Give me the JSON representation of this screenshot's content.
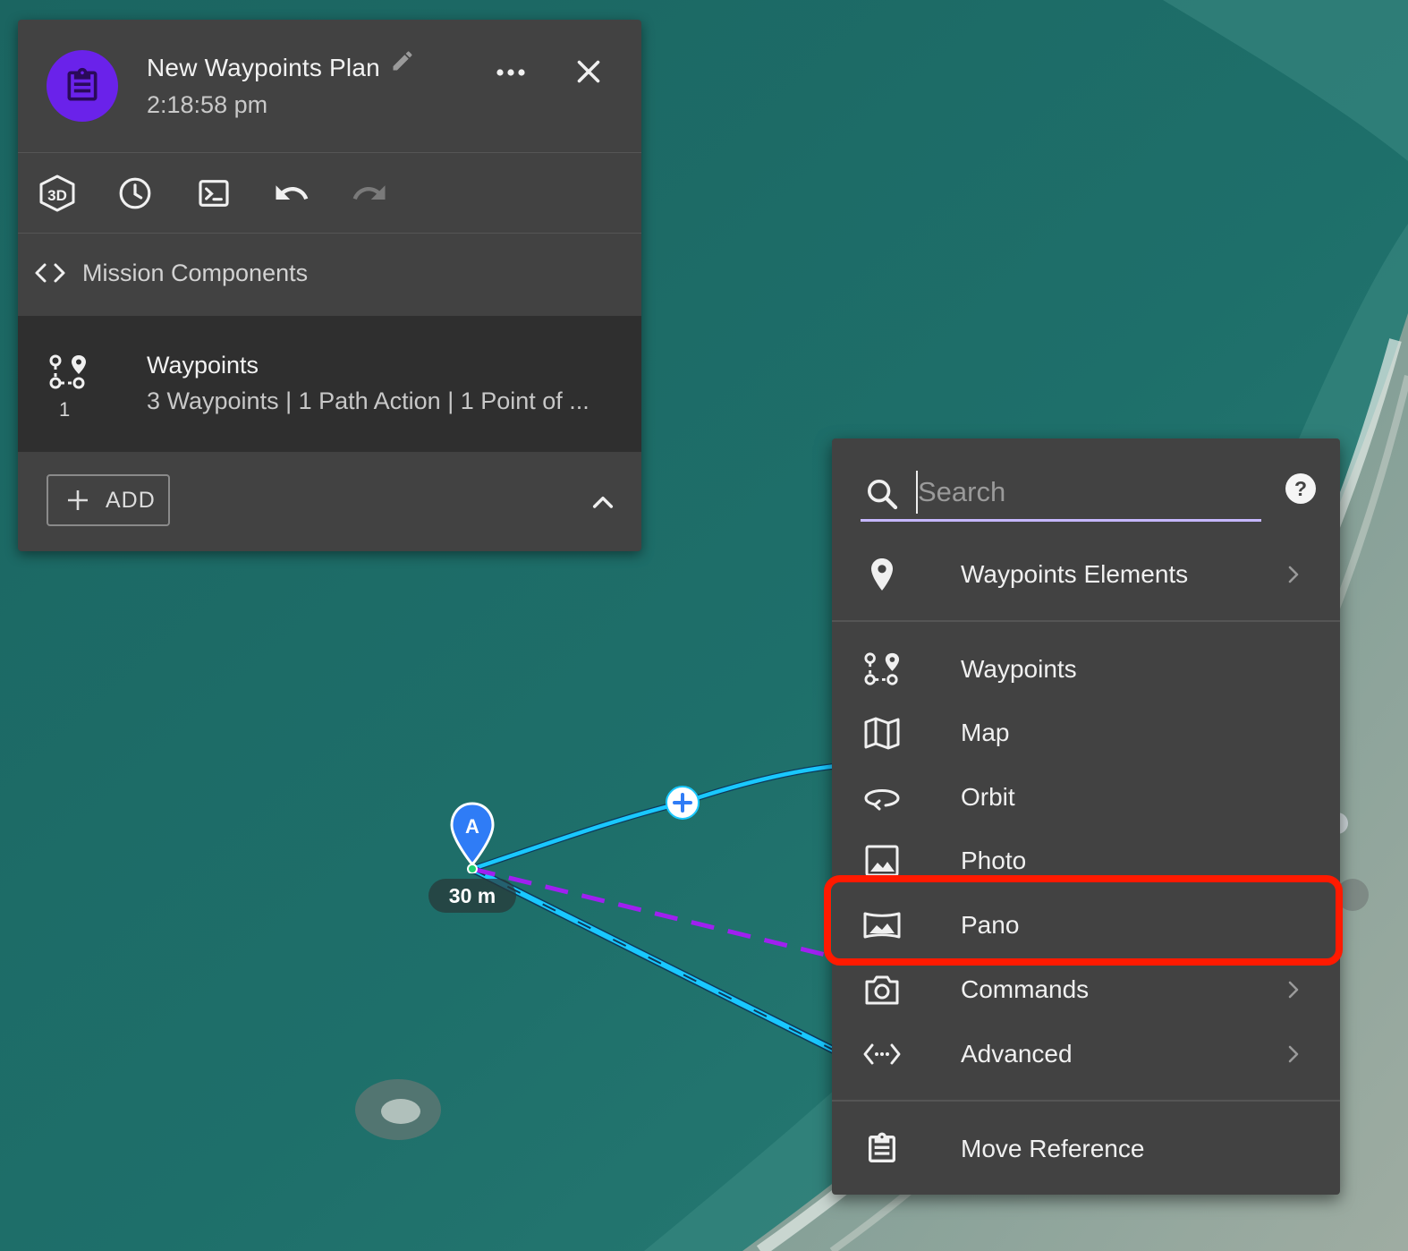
{
  "panel": {
    "title": "New Waypoints Plan",
    "time": "2:18:58 pm",
    "toolbar": {
      "view3d_icon": "3d-view-icon",
      "history_icon": "clock-icon",
      "terminal_icon": "terminal-icon",
      "undo_icon": "undo-icon",
      "redo_icon": "redo-icon"
    },
    "section_label": "Mission Components",
    "component": {
      "title": "Waypoints",
      "subtitle": "3 Waypoints | 1 Path Action | 1 Point of ...",
      "count": "1"
    },
    "add_label": "ADD"
  },
  "map": {
    "marker_label": "A",
    "altitude": "30 m"
  },
  "menu": {
    "search_placeholder": "Search",
    "items": [
      {
        "label": "Waypoints Elements",
        "icon": "location-pin-icon",
        "submenu": true
      },
      {
        "label": "Waypoints",
        "icon": "waypoints-route-icon",
        "submenu": false
      },
      {
        "label": "Map",
        "icon": "map-icon",
        "submenu": false
      },
      {
        "label": "Orbit",
        "icon": "orbit-icon",
        "submenu": false
      },
      {
        "label": "Photo",
        "icon": "photo-icon",
        "submenu": false
      },
      {
        "label": "Pano",
        "icon": "panorama-icon",
        "submenu": false
      },
      {
        "label": "Commands",
        "icon": "camera-icon",
        "submenu": true
      },
      {
        "label": "Advanced",
        "icon": "code-dots-icon",
        "submenu": true
      },
      {
        "label": "Move Reference",
        "icon": "clipboard-icon",
        "submenu": false
      }
    ]
  },
  "colors": {
    "accent_purple": "#6a22ea",
    "route_cyan": "#19c8ff",
    "dashed_purple": "#a020f0",
    "highlight_red": "#ff1a00",
    "marker_blue": "#2f7cf6"
  }
}
